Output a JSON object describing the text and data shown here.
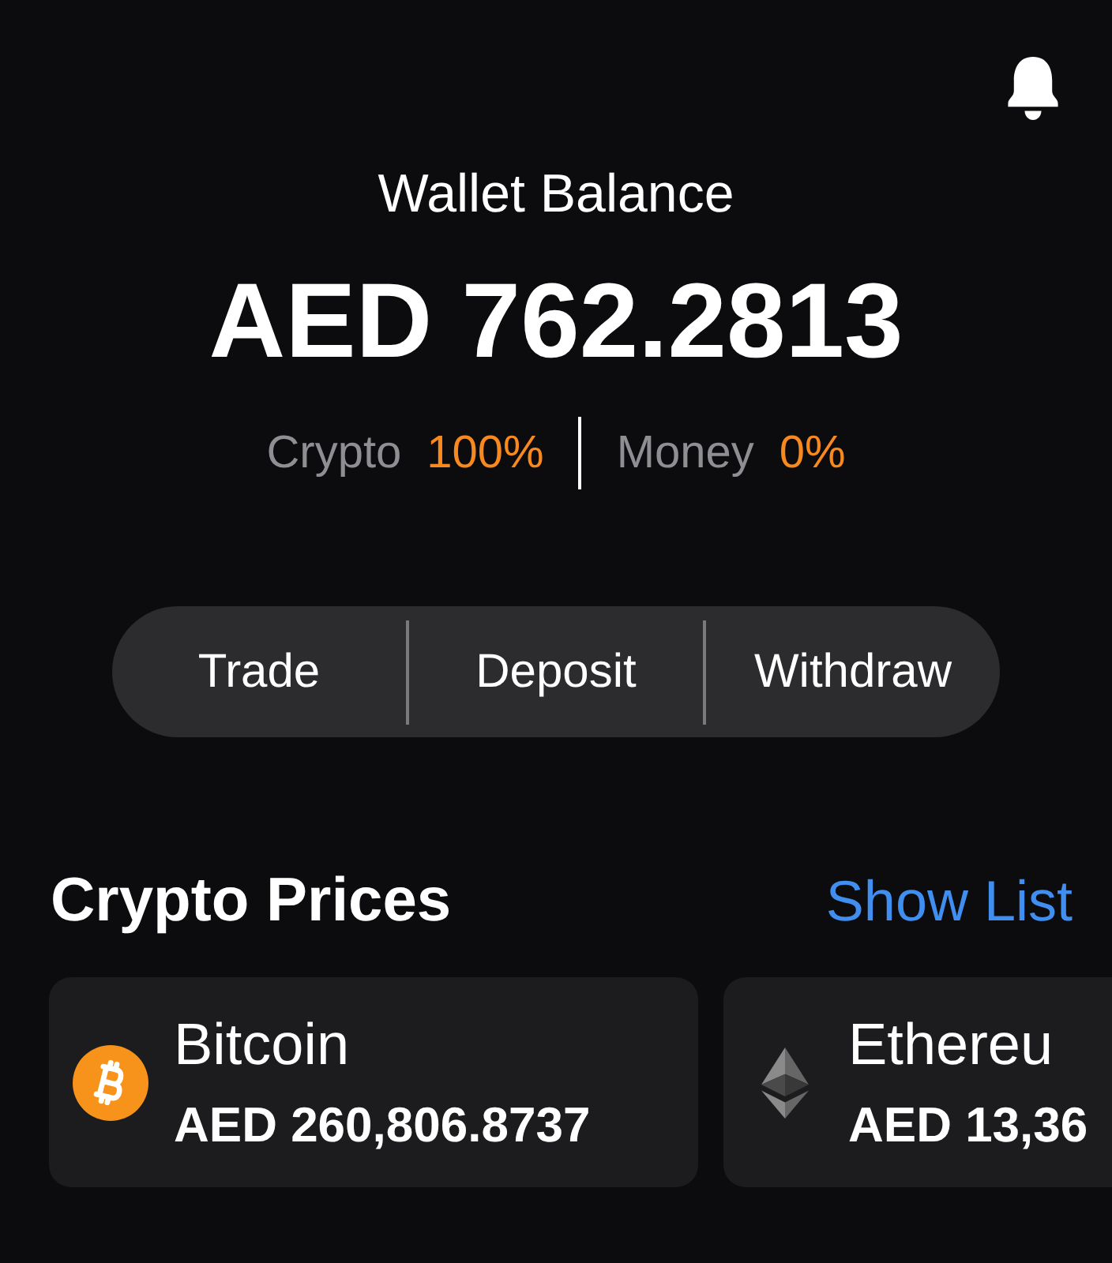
{
  "balance": {
    "label": "Wallet Balance",
    "amount": "AED 762.2813"
  },
  "allocation": [
    {
      "label": "Crypto",
      "value": "100%"
    },
    {
      "label": "Money",
      "value": "0%"
    }
  ],
  "actions": [
    "Trade",
    "Deposit",
    "Withdraw"
  ],
  "crypto_prices": {
    "title": "Crypto Prices",
    "link": "Show List",
    "coins": [
      {
        "kind": "bitcoin",
        "name": "Bitcoin",
        "price": "AED 260,806.8737"
      },
      {
        "kind": "ethereum",
        "name": "Ethereu",
        "price": "AED 13,36"
      }
    ]
  }
}
